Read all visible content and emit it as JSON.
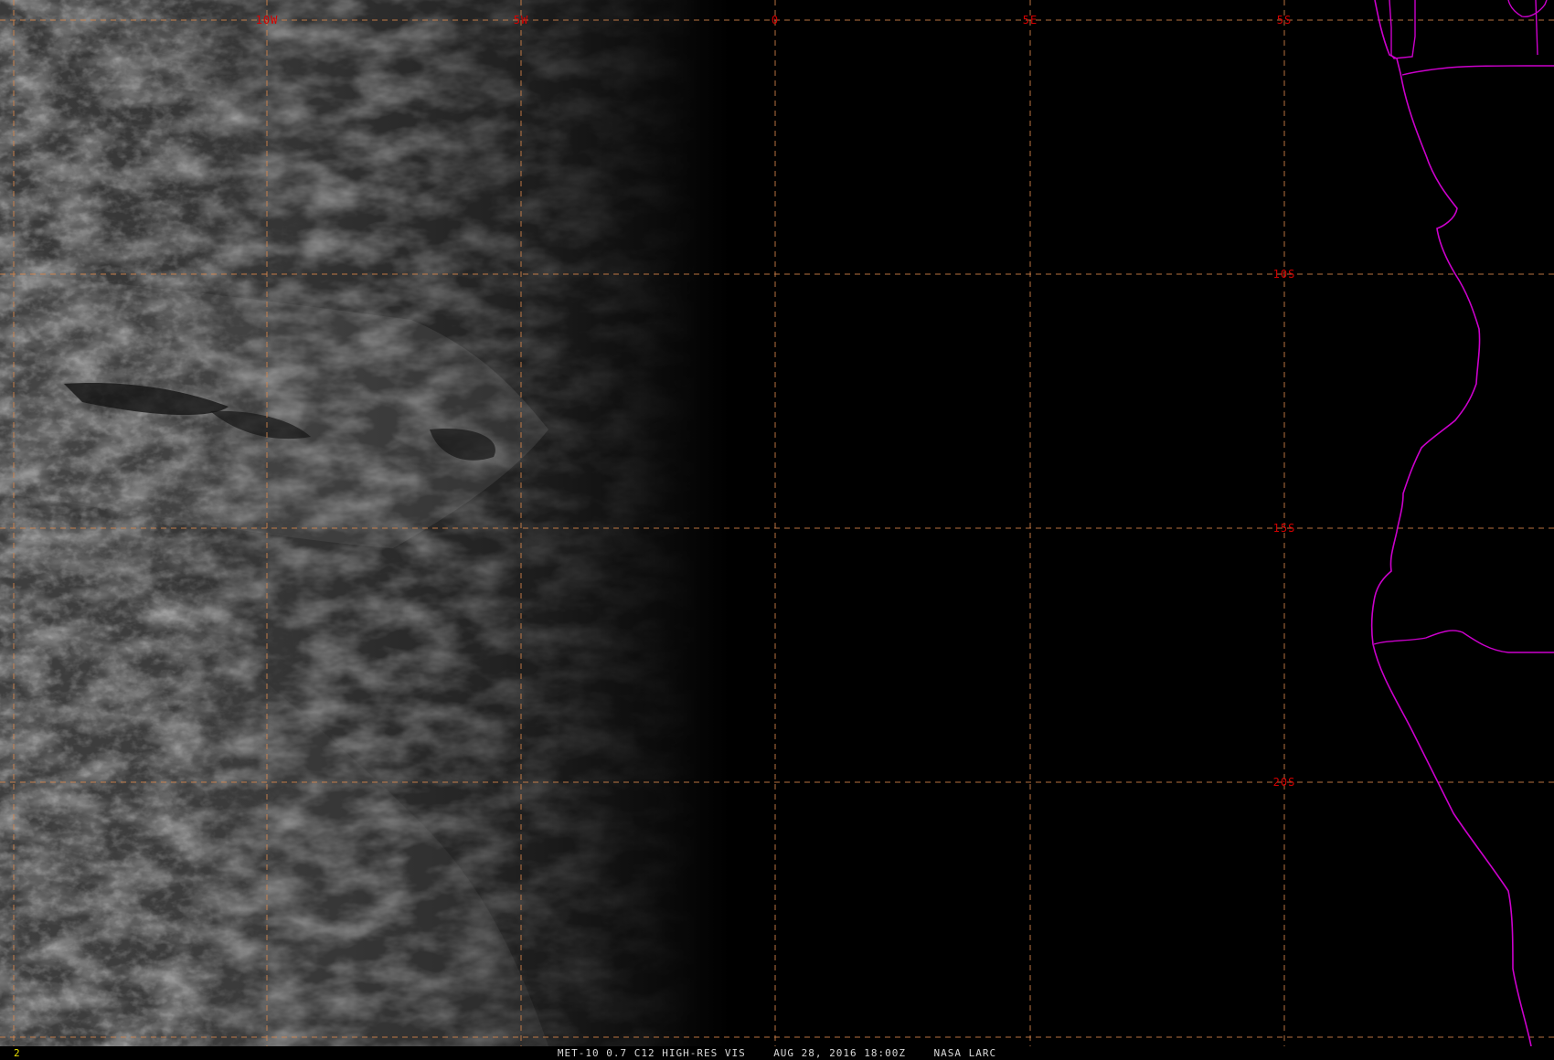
{
  "caption": {
    "satellite": "MET-10",
    "channel": "0.7 C12 HIGH-RES VIS",
    "datetime": "AUG 28, 2016 18:00Z",
    "source": "NASA LARC"
  },
  "frame_number": "2",
  "longitude_labels": [
    "10W",
    "5W",
    "0",
    "5E"
  ],
  "latitude_labels": [
    "5S",
    "10S",
    "15S",
    "20S"
  ],
  "colors": {
    "grid": "#d9864a",
    "grid_label": "#d40000",
    "coastline": "#cc00cc",
    "frame_number": "#e8e000",
    "caption": "#d8d8d8",
    "background": "#000000"
  },
  "icons": {
    "coastline": "coastline-outline",
    "border": "country-border-outline"
  }
}
